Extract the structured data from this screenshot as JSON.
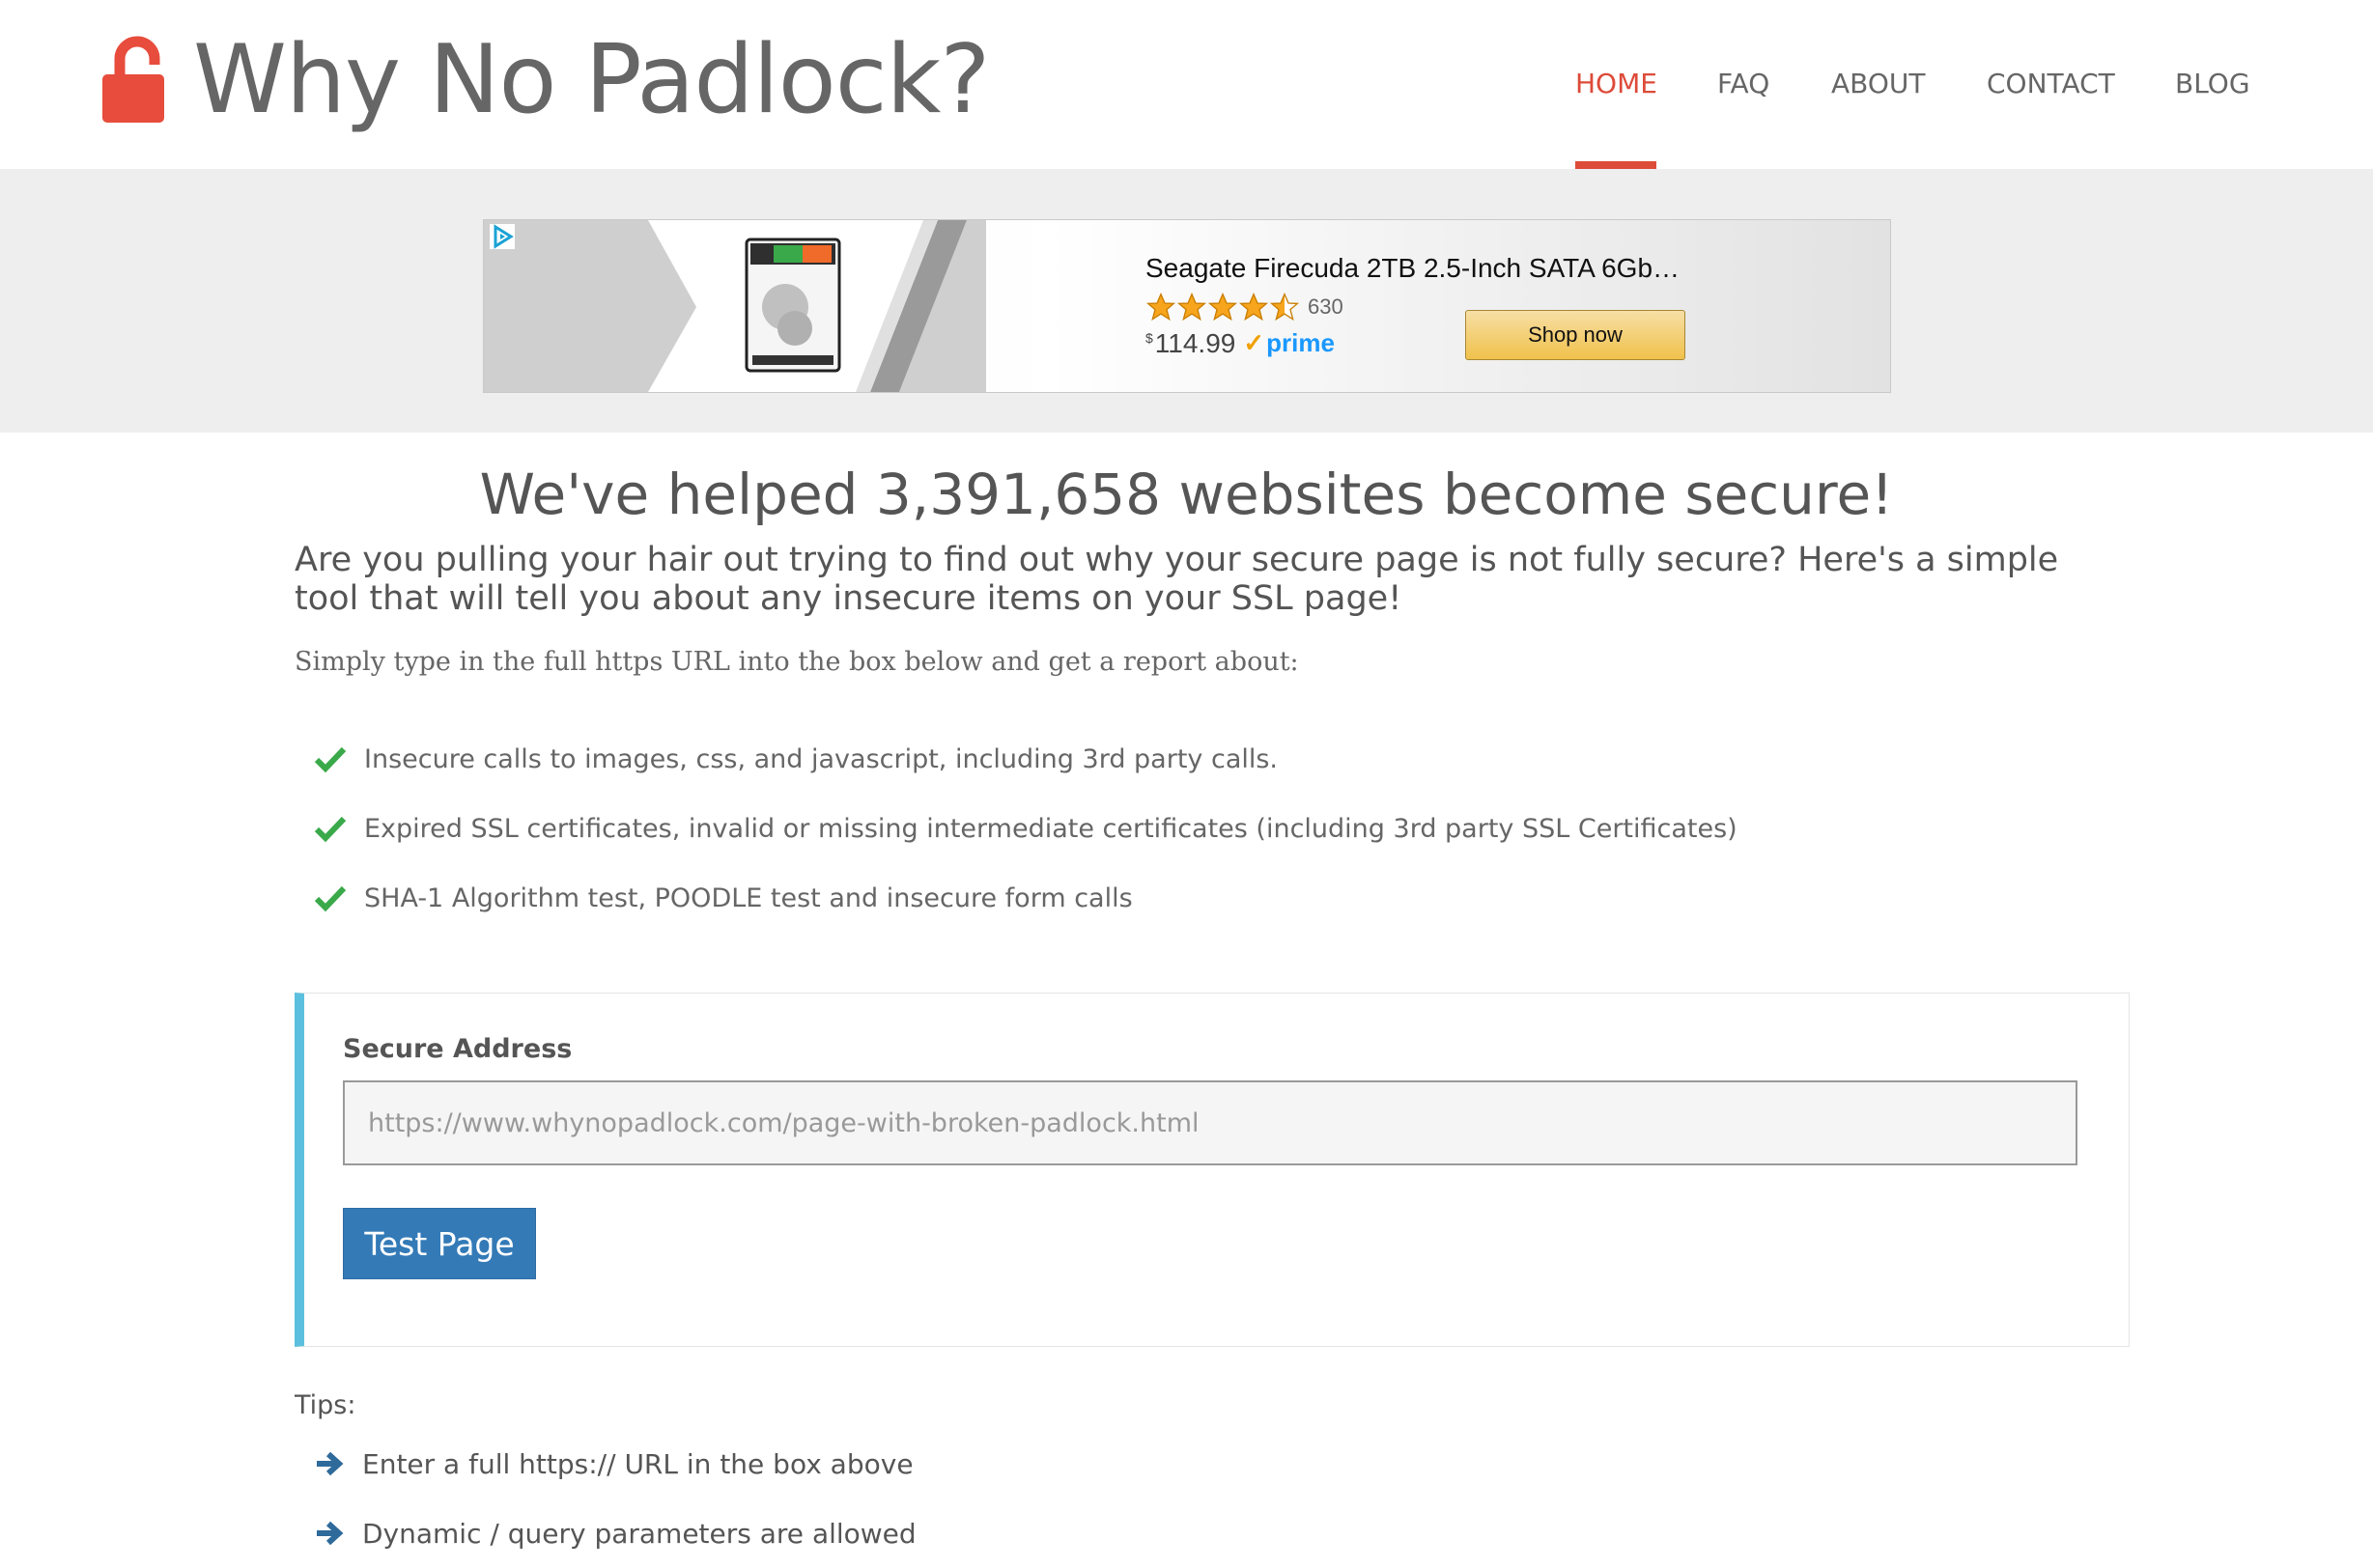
{
  "header": {
    "brand": "Why No Padlock?",
    "nav": [
      {
        "label": "HOME",
        "active": true
      },
      {
        "label": "FAQ",
        "active": false
      },
      {
        "label": "ABOUT",
        "active": false
      },
      {
        "label": "CONTACT",
        "active": false
      },
      {
        "label": "BLOG",
        "active": false
      }
    ],
    "accent_color": "#dd4b39"
  },
  "ad": {
    "product_title": "Seagate Firecuda 2TB 2.5-Inch SATA 6Gb…",
    "rating": 4.5,
    "review_count": "630",
    "currency": "$",
    "price": "114.99",
    "prime_label": "prime",
    "cta": "Shop now"
  },
  "main": {
    "headline": "We've helped 3,391,658 websites become secure!",
    "lead": "Are you pulling your hair out trying to find out why your secure page is not fully secure? Here's a simple tool that will tell you about any insecure items on your SSL page!",
    "instructions": "Simply type in the full https URL into the box below and get a report about:",
    "features": [
      "Insecure calls to images, css, and javascript, including 3rd party calls.",
      "Expired SSL certificates, invalid or missing intermediate certificates (including 3rd party SSL Certificates)",
      "SHA-1 Algorithm test, POODLE test and insecure form calls"
    ]
  },
  "form": {
    "label": "Secure Address",
    "placeholder": "https://www.whynopadlock.com/page-with-broken-padlock.html",
    "value": "",
    "submit_label": "Test Page"
  },
  "tips": {
    "title": "Tips:",
    "items": [
      "Enter a full https:// URL in the box above",
      "Dynamic / query parameters are allowed"
    ]
  },
  "colors": {
    "check": "#3aa94a",
    "arrow": "#2e6a9a",
    "panel_accent": "#5bc0de",
    "button": "#337ab7"
  }
}
